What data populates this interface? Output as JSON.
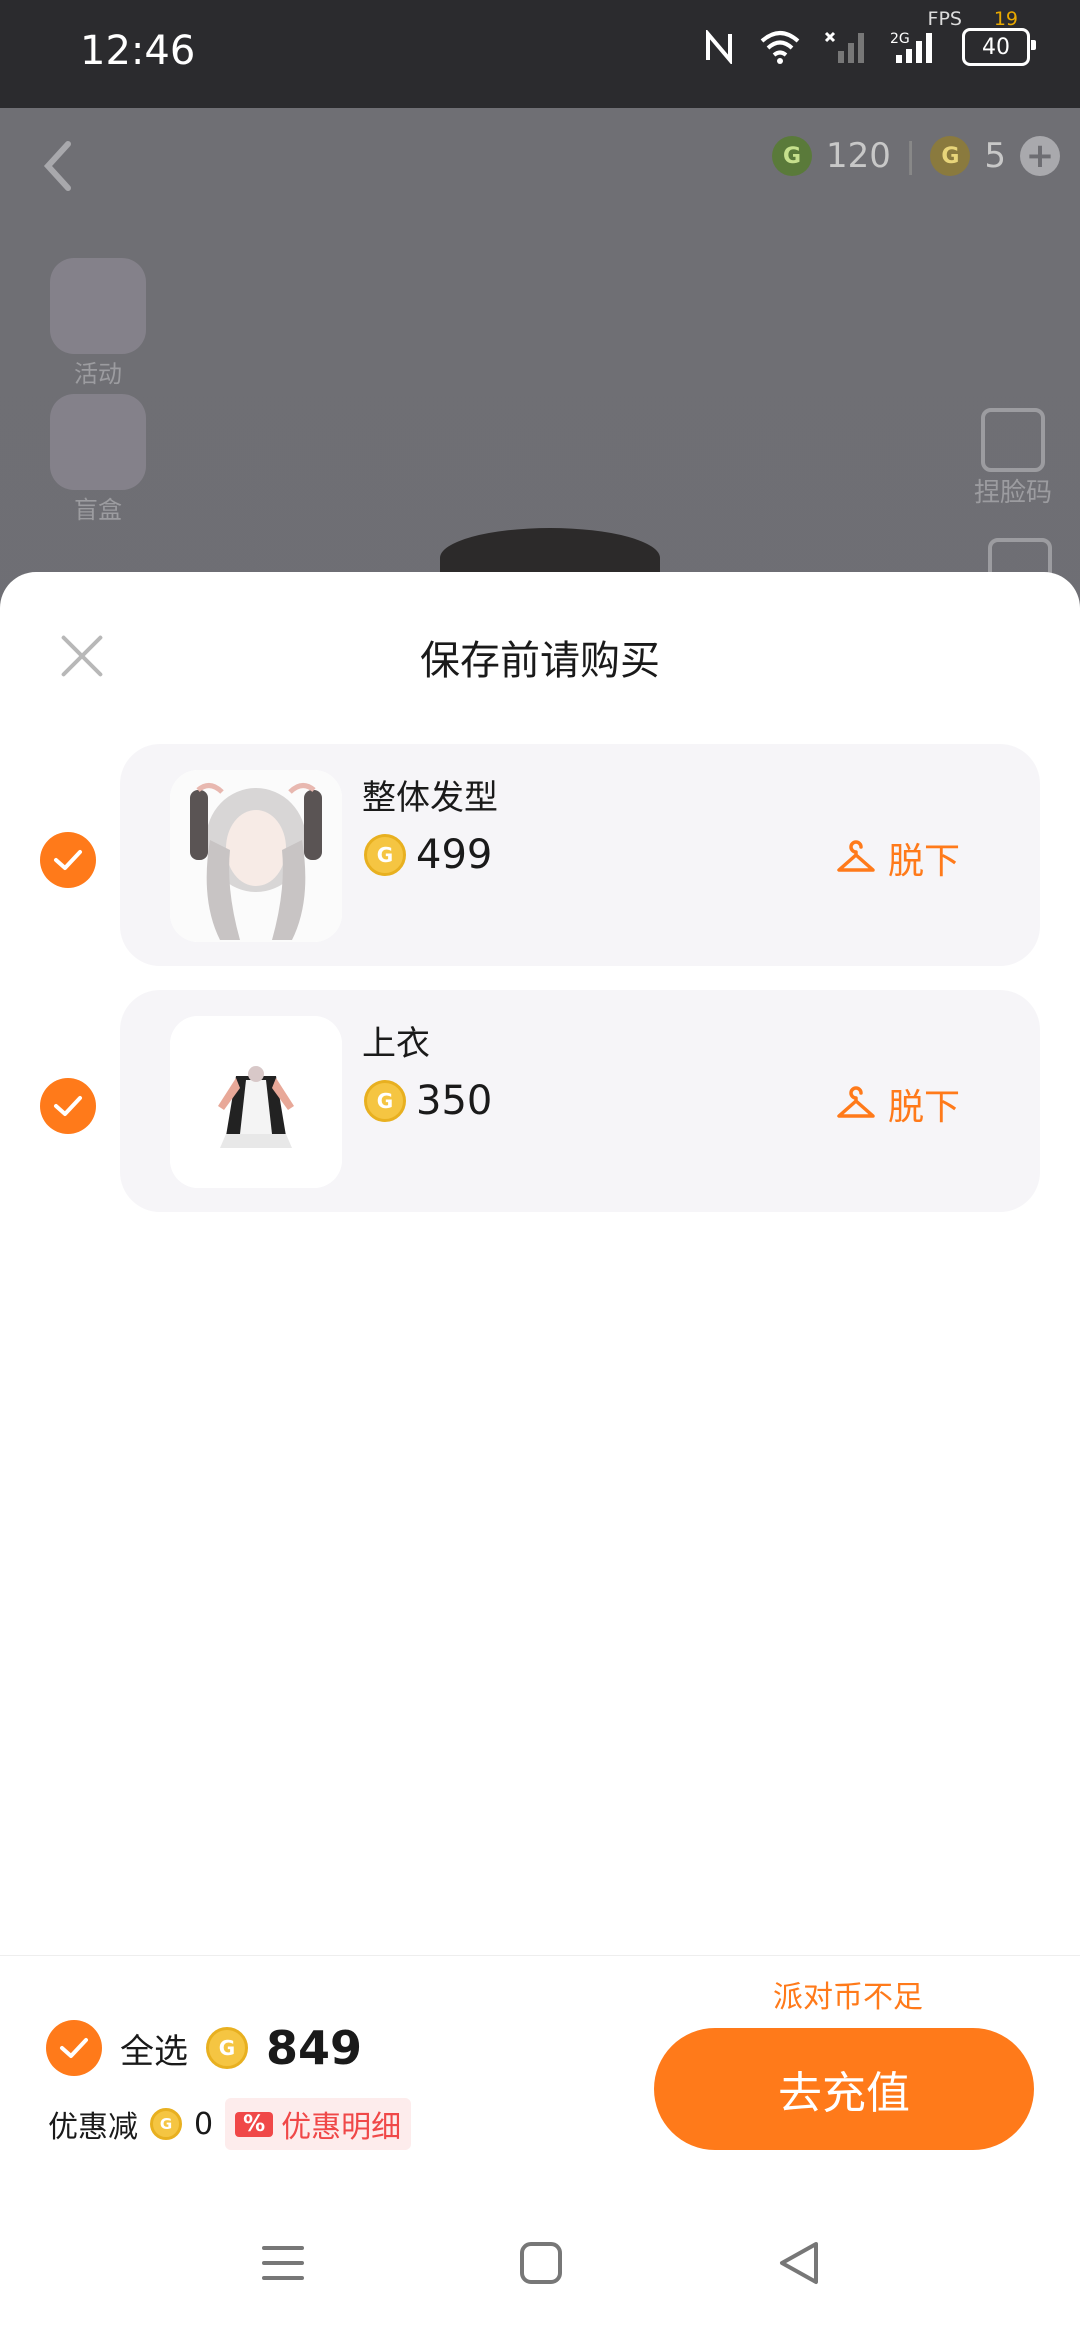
{
  "status_bar": {
    "time": "12:46",
    "fps_label": "FPS",
    "fps_value": "19",
    "battery": "40",
    "network": "2G"
  },
  "background": {
    "currency_green": "120",
    "currency_gold": "5",
    "side_items": [
      "活动",
      "盲盒"
    ],
    "right_items": [
      "捏脸码"
    ]
  },
  "sheet": {
    "title": "保存前请购买",
    "items": [
      {
        "name": "整体发型",
        "price": "499",
        "action": "脱下"
      },
      {
        "name": "上衣",
        "price": "350",
        "action": "脱下"
      }
    ],
    "insufficient": "派对币不足",
    "select_all": "全选",
    "total": "849",
    "discount_label": "优惠减",
    "discount_value": "0",
    "discount_badge": "%",
    "discount_detail": "优惠明细",
    "recharge": "去充值"
  },
  "colors": {
    "accent": "#ff7a1a",
    "coin": "#f5c542",
    "discount": "#f04848"
  }
}
